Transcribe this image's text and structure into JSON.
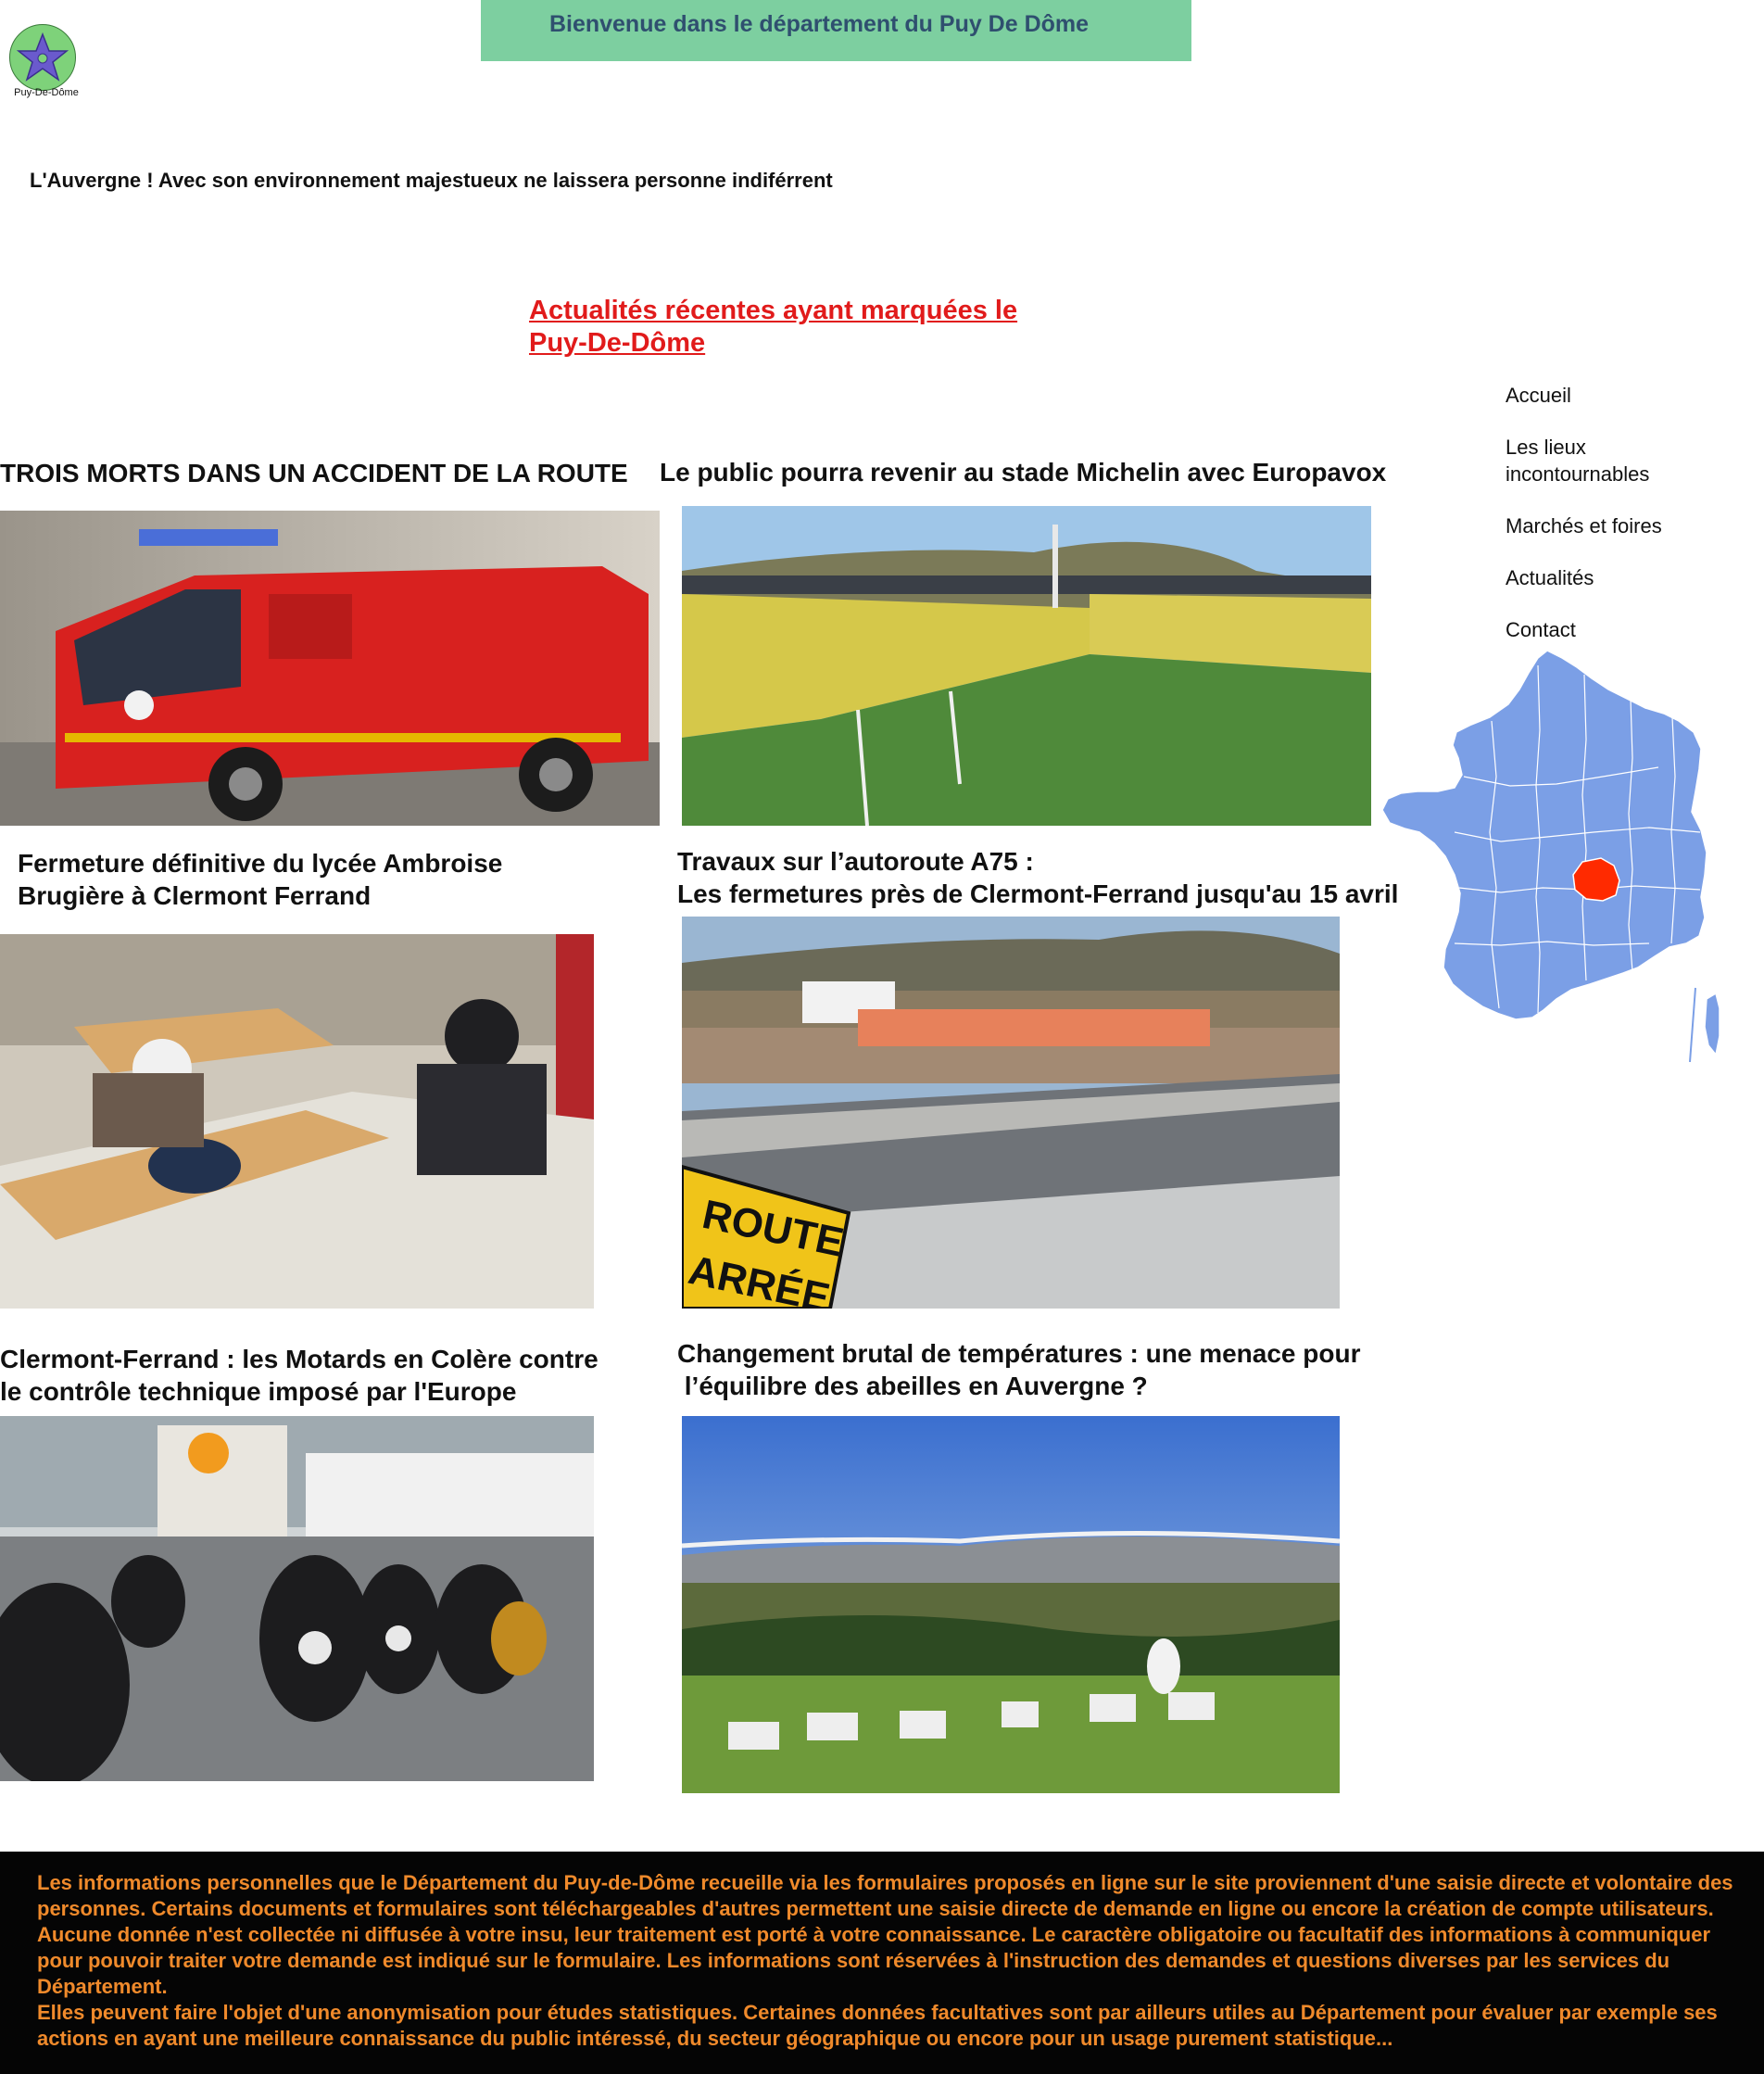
{
  "header": {
    "banner_title": "Bienvenue dans le département du Puy De Dôme",
    "logo_caption": "Puy-De-Dôme",
    "tagline": "L'Auvergne ! Avec son environnement majestueux ne laissera personne indiférrent"
  },
  "section": {
    "title_line1": "Actualités récentes ayant marquées le",
    "title_line2": "Puy-De-Dôme"
  },
  "nav": {
    "items": [
      {
        "label": "Accueil"
      },
      {
        "label_line1": "Les lieux",
        "label_line2": "incontournables"
      },
      {
        "label": "Marchés et foires"
      },
      {
        "label": "Actualités"
      },
      {
        "label": "Contact"
      }
    ]
  },
  "news": [
    {
      "title": "TROIS MORTS DANS UN ACCIDENT DE LA ROUTE",
      "image": "fire-truck-photo"
    },
    {
      "title": "Le public pourra revenir au stade Michelin avec Europavox",
      "image": "stadium-photo"
    },
    {
      "title_line1": "Fermeture définitive du lycée Ambroise",
      "title_line2": "Brugière à Clermont Ferrand",
      "image": "classroom-photo"
    },
    {
      "title_line1": "Travaux sur l’autoroute A75 :",
      "title_line2": "Les fermetures près de Clermont-Ferrand jusqu'au 15 avril",
      "image": "roadworks-photo",
      "sign_text_1": "ROUTE",
      "sign_text_2": "ARRÉE"
    },
    {
      "title_line1": "Clermont-Ferrand : les Motards en Colère contre",
      "title_line2": "le contrôle technique imposé par l'Europe",
      "image": "motorcycles-photo"
    },
    {
      "title_line1": "Changement brutal de températures : une menace pour",
      "title_line2": " l’équilibre des abeilles en Auvergne ?",
      "image": "beehives-photo"
    }
  ],
  "map": {
    "highlight_color": "#ff2a00",
    "base_color": "#7b9fe6"
  },
  "colors": {
    "banner": "#7dcfa0",
    "accent_red": "#e11b1b",
    "footer_bg": "#050505",
    "footer_text": "#f08a2b"
  },
  "footer": {
    "paragraph1": "Les informations personnelles que le Département du Puy-de-Dôme recueille via les formulaires proposés en ligne sur le site proviennent d'une saisie directe et volontaire des personnes. Certains documents et formulaires sont téléchargeables d'autres permettent une saisie directe de demande en ligne ou encore la création de compte utilisateurs. Aucune donnée n'est collectée ni diffusée à votre insu, leur traitement est porté à votre connaissance. Le caractère obligatoire ou facultatif des informations à communiquer pour pouvoir traiter votre demande est indiqué sur le formulaire. Les informations sont réservées à l'instruction des demandes et questions diverses par les services du Département.",
    "paragraph2": "Elles peuvent faire l'objet d'une anonymisation pour études statistiques. Certaines données facultatives sont par ailleurs utiles au Département pour évaluer par exemple ses actions en ayant une meilleure connaissance du public intéressé, du secteur géographique ou encore pour un usage purement statistique..."
  }
}
